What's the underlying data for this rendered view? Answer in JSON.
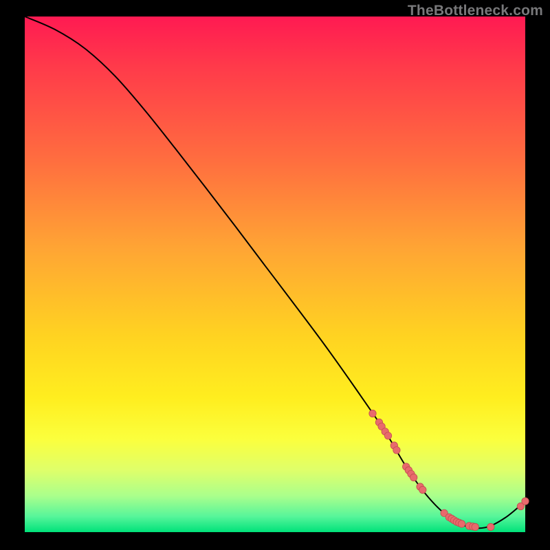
{
  "watermark": "TheBottleneck.com",
  "colors": {
    "frame": "#000000",
    "curve_stroke": "#000000",
    "marker_fill": "#e86a6c",
    "marker_stroke": "#c24d50"
  },
  "chart_data": {
    "type": "line",
    "title": "",
    "xlabel": "",
    "ylabel": "",
    "xlim": [
      0,
      100
    ],
    "ylim": [
      0,
      100
    ],
    "grid": false,
    "curve": [
      {
        "x": 0,
        "y": 100
      },
      {
        "x": 6,
        "y": 97.5
      },
      {
        "x": 12,
        "y": 93.8
      },
      {
        "x": 18,
        "y": 88.5
      },
      {
        "x": 24,
        "y": 81.8
      },
      {
        "x": 30,
        "y": 74.5
      },
      {
        "x": 36,
        "y": 67.0
      },
      {
        "x": 42,
        "y": 59.4
      },
      {
        "x": 48,
        "y": 51.7
      },
      {
        "x": 54,
        "y": 44.0
      },
      {
        "x": 60,
        "y": 36.2
      },
      {
        "x": 66,
        "y": 28.0
      },
      {
        "x": 72,
        "y": 19.5
      },
      {
        "x": 76,
        "y": 13.0
      },
      {
        "x": 80,
        "y": 7.5
      },
      {
        "x": 84,
        "y": 3.5
      },
      {
        "x": 88,
        "y": 1.2
      },
      {
        "x": 92,
        "y": 0.9
      },
      {
        "x": 96,
        "y": 2.8
      },
      {
        "x": 100,
        "y": 6.0
      }
    ],
    "markers": [
      {
        "x": 69.5,
        "y": 23.0
      },
      {
        "x": 70.8,
        "y": 21.3
      },
      {
        "x": 71.3,
        "y": 20.5
      },
      {
        "x": 72.0,
        "y": 19.5
      },
      {
        "x": 72.6,
        "y": 18.7
      },
      {
        "x": 73.8,
        "y": 16.8
      },
      {
        "x": 74.3,
        "y": 15.9
      },
      {
        "x": 76.2,
        "y": 12.7
      },
      {
        "x": 76.7,
        "y": 12.0
      },
      {
        "x": 77.2,
        "y": 11.3
      },
      {
        "x": 77.7,
        "y": 10.6
      },
      {
        "x": 79.0,
        "y": 8.8
      },
      {
        "x": 79.5,
        "y": 8.2
      },
      {
        "x": 83.8,
        "y": 3.7
      },
      {
        "x": 84.8,
        "y": 2.9
      },
      {
        "x": 85.3,
        "y": 2.6
      },
      {
        "x": 85.8,
        "y": 2.3
      },
      {
        "x": 86.3,
        "y": 2.0
      },
      {
        "x": 86.8,
        "y": 1.8
      },
      {
        "x": 87.3,
        "y": 1.6
      },
      {
        "x": 88.8,
        "y": 1.2
      },
      {
        "x": 89.5,
        "y": 1.1
      },
      {
        "x": 90.0,
        "y": 1.0
      },
      {
        "x": 93.1,
        "y": 1.0
      },
      {
        "x": 99.1,
        "y": 5.0
      },
      {
        "x": 100.0,
        "y": 6.0
      }
    ]
  }
}
